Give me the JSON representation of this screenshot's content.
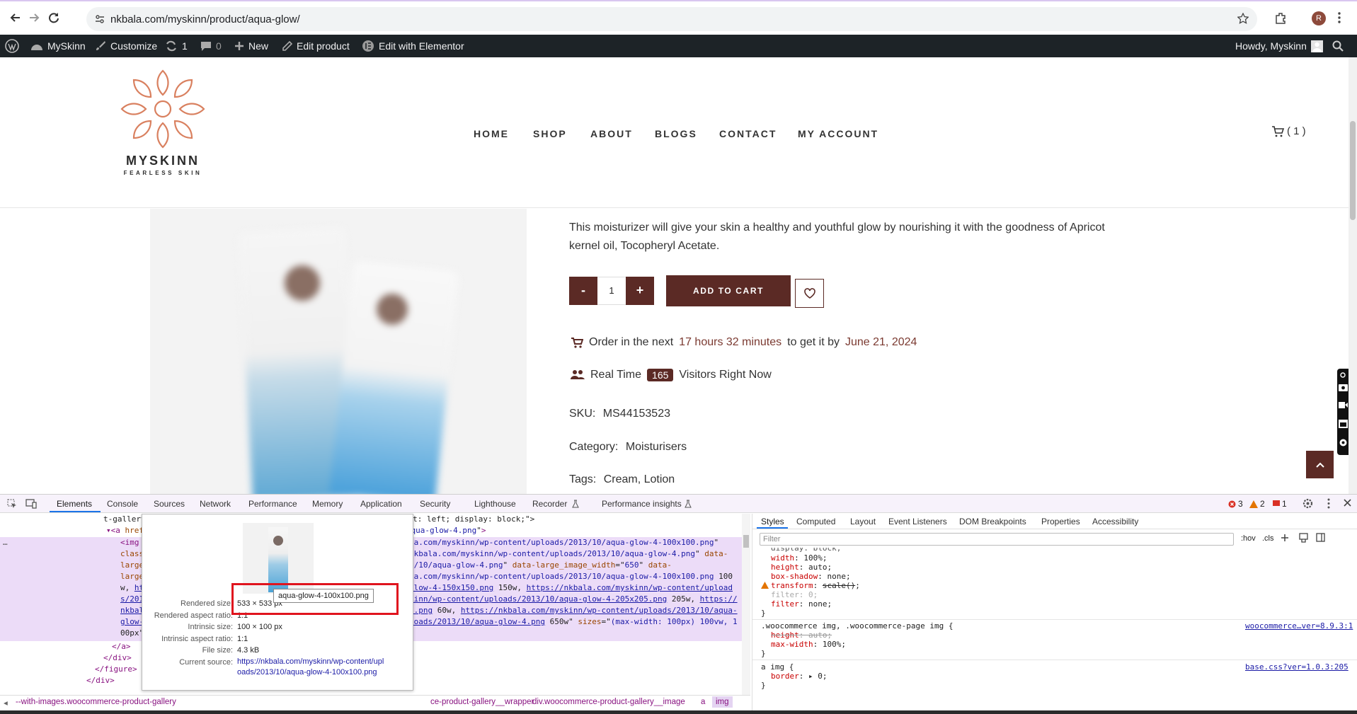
{
  "browser": {
    "url": "nkbala.com/myskinn/product/aqua-glow/",
    "profile_initial": "R"
  },
  "wpbar": {
    "site": "MySkinn",
    "customize": "Customize",
    "updates": "1",
    "comments": "0",
    "new": "New",
    "edit_product": "Edit product",
    "elementor": "Edit with Elementor",
    "howdy": "Howdy, Myskinn"
  },
  "site": {
    "logo_title": "MYSKINN",
    "logo_tag": "FEARLESS SKIN",
    "menu": [
      "HOME",
      "SHOP",
      "ABOUT",
      "BLOGS",
      "CONTACT",
      "MY ACCOUNT"
    ],
    "cart_count": "( 1 )",
    "brand_color": "#5b2a25",
    "accent_color": "#7b3a31"
  },
  "product": {
    "description_line1": "This moisturizer will give your skin a healthy and youthful glow by nourishing it with the goodness of Apricot",
    "description_line2": "kernel oil, Tocopheryl Acetate.",
    "qty_minus": "-",
    "qty": "1",
    "qty_plus": "+",
    "add_to_cart": "ADD TO CART",
    "order_prefix": "Order in the next",
    "order_time": "17 hours 32 minutes",
    "order_mid": "to get it by",
    "order_date": "June 21, 2024",
    "realtime_prefix": "Real Time",
    "visitors": "165",
    "realtime_suffix": "Visitors Right Now",
    "sku_label": "SKU:",
    "sku": "MS44153523",
    "category_label": "Category:",
    "category": "Moisturisers",
    "tags_label": "Tags:",
    "tags": "Cream, Lotion"
  },
  "devtools": {
    "tabs": [
      "Elements",
      "Console",
      "Sources",
      "Network",
      "Performance",
      "Memory",
      "Application",
      "Security",
      "Lighthouse",
      "Recorder",
      "Performance insights"
    ],
    "errors": "3",
    "warnings": "2",
    "issues": "1",
    "side_tabs": [
      "Styles",
      "Computed",
      "Layout",
      "Event Listeners",
      "DOM Breakpoints",
      "Properties",
      "Accessibility"
    ],
    "filter_placeholder": "Filter",
    "hov": ":hov",
    "cls": ".cls",
    "tooltip": {
      "filename": "aqua-glow-4-100x100.png",
      "rendered_size_label": "Rendered size:",
      "rendered_size": "533 × 533 px",
      "rendered_aspect_label": "Rendered aspect ratio:",
      "rendered_aspect": "1:1",
      "intrinsic_size_label": "Intrinsic size:",
      "intrinsic_size": "100 × 100 px",
      "intrinsic_aspect_label": "Intrinsic aspect ratio:",
      "intrinsic_aspect": "1:1",
      "file_size_label": "File size:",
      "file_size": "4.3 kB",
      "current_source_label": "Current source:",
      "current_source_1": "https://nkbala.com/myskinn/wp-content/upl",
      "current_source_2": "oads/2013/10/aqua-glow-4-100x100.png"
    },
    "breadcrumb": [
      "--with-images.woocommerce-product-gallery",
      "ce-product-gallery__wrapper",
      "div.woocommerce-product-gallery__image",
      "a",
      "img"
    ],
    "rule1_source": "woocommerce…ver=8.9.3:1",
    "rule2_source": "base.css?ver=1.0.3:205"
  }
}
